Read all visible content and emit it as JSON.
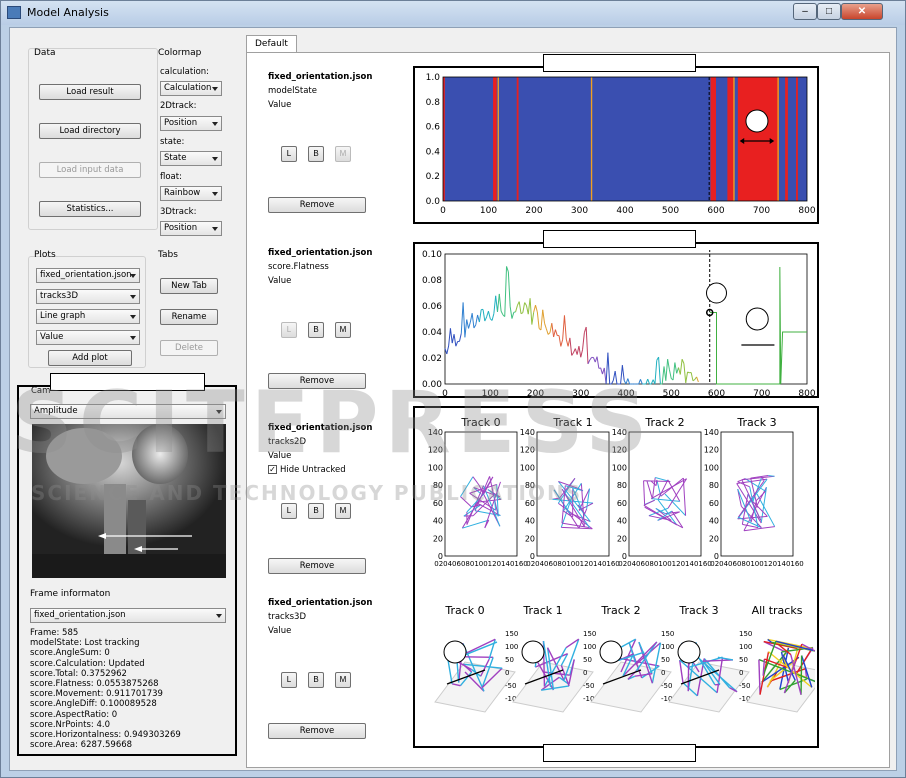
{
  "window": {
    "title": "Model Analysis",
    "min": "–",
    "max": "□",
    "close": "✕"
  },
  "data_group": {
    "label": "Data",
    "load_result": "Load result",
    "load_directory": "Load directory",
    "load_input": "Load input data",
    "statistics": "Statistics..."
  },
  "colormap": {
    "label": "Colormap",
    "calc_label": "calculation:",
    "calc_value": "Calculation",
    "track2d_label": "2Dtrack:",
    "track2d_value": "Position",
    "state_label": "state:",
    "state_value": "State",
    "float_label": "float:",
    "float_value": "Rainbow",
    "track3d_label": "3Dtrack:",
    "track3d_value": "Position"
  },
  "plots": {
    "label": "Plots",
    "file": "fixed_orientation.json",
    "var": "tracks3D",
    "type": "Line graph",
    "value": "Value",
    "add": "Add plot"
  },
  "tabs_group": {
    "label": "Tabs",
    "new_tab": "New Tab",
    "rename": "Rename",
    "delete": "Delete"
  },
  "camera": {
    "label": "Cam",
    "mode": "Amplitude"
  },
  "frame": {
    "label": "Frame informaton",
    "file": "fixed_orientation.json",
    "lines": [
      "Frame: 585",
      "modelState: Lost tracking",
      "score.AngleSum: 0",
      "score.Calculation: Updated",
      "score.Total: 0.3752962",
      "score.Flatness: 0.0553875268",
      "score.Movement: 0.911701739",
      "score.AngleDiff: 0.100089528",
      "score.AspectRatio: 0",
      "score.NrPoints: 4.0",
      "score.Horizontalness: 0.949303269",
      "score.Area: 6287.59668"
    ]
  },
  "tab_default": "Default",
  "plot_panels": [
    {
      "file": "fixed_orientation.json",
      "var": "modelState",
      "kind": "Value",
      "l": "L",
      "b": "B",
      "m": "M",
      "remove": "Remove"
    },
    {
      "file": "fixed_orientation.json",
      "var": "score.Flatness",
      "kind": "Value",
      "l": "L",
      "b": "B",
      "m": "M",
      "remove": "Remove"
    },
    {
      "file": "fixed_orientation.json",
      "var": "tracks2D",
      "kind": "Value",
      "hide": "Hide Untracked",
      "l": "L",
      "b": "B",
      "m": "M",
      "remove": "Remove"
    },
    {
      "file": "fixed_orientation.json",
      "var": "tracks3D",
      "kind": "Value",
      "l": "L",
      "b": "B",
      "m": "M",
      "remove": "Remove"
    }
  ],
  "chart_data": [
    {
      "type": "area",
      "title": "",
      "xlim": [
        0,
        800
      ],
      "ylim": [
        0,
        1.0
      ],
      "xticks": [
        "0",
        "100",
        "200",
        "300",
        "400",
        "500",
        "600",
        "700",
        "800"
      ],
      "yticks": [
        "0.0",
        "0.2",
        "0.4",
        "0.6",
        "0.8",
        "1.0"
      ],
      "base_color": "#3a4fb0",
      "highlight_color": "#e82020",
      "red_spans": [
        [
          0,
          4
        ],
        [
          110,
          118
        ],
        [
          162,
          166
        ],
        [
          588,
          600
        ],
        [
          625,
          640
        ],
        [
          648,
          738
        ],
        [
          752,
          758
        ],
        [
          776,
          780
        ]
      ],
      "orange_lines": [
        [
          120,
          123
        ],
        [
          325,
          328
        ],
        [
          638,
          641
        ],
        [
          735,
          738
        ]
      ],
      "cursor_x": 585
    },
    {
      "type": "line",
      "title": "",
      "xlim": [
        0,
        800
      ],
      "ylim": [
        0,
        0.1
      ],
      "xticks": [
        "0",
        "100",
        "200",
        "300",
        "400",
        "500",
        "600",
        "700",
        "800"
      ],
      "yticks": [
        "0.00",
        "0.02",
        "0.04",
        "0.06",
        "0.08",
        "0.10"
      ],
      "cursor_x": 585,
      "cursor_y": 0.055
    },
    {
      "type": "scatter",
      "panels": [
        "Track 0",
        "Track 1",
        "Track 2",
        "Track 3"
      ],
      "yticks": [
        "0",
        "20",
        "40",
        "60",
        "80",
        "100",
        "120",
        "140"
      ],
      "xticks_text": "020406080100120140160"
    },
    {
      "type": "scatter",
      "panels": [
        "Track 0",
        "Track 1",
        "Track 2",
        "Track 3",
        "All tracks"
      ]
    }
  ],
  "watermark": {
    "big": "SCITEPRESS",
    "small": "SCIENCE AND TECHNOLOGY PUBLICATIONS"
  }
}
